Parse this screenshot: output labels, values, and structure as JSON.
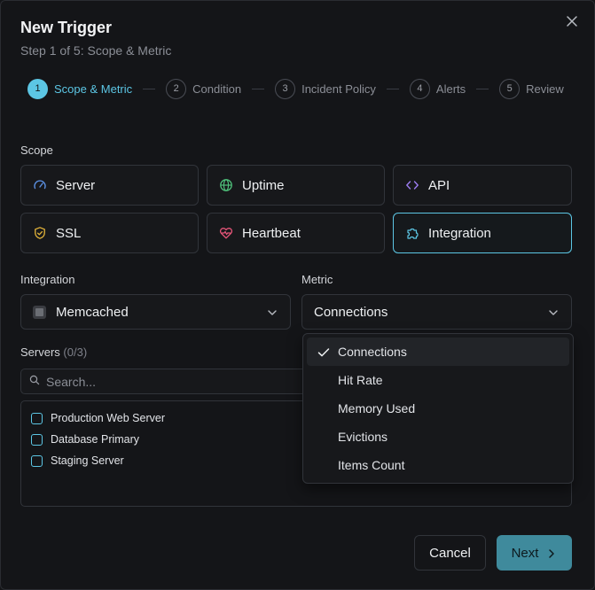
{
  "dialog": {
    "title": "New Trigger",
    "subtitle": "Step 1 of 5: Scope & Metric"
  },
  "steps": [
    {
      "number": "1",
      "label": "Scope & Metric",
      "active": true
    },
    {
      "number": "2",
      "label": "Condition",
      "active": false
    },
    {
      "number": "3",
      "label": "Incident Policy",
      "active": false
    },
    {
      "number": "4",
      "label": "Alerts",
      "active": false
    },
    {
      "number": "5",
      "label": "Review",
      "active": false
    }
  ],
  "scope": {
    "label": "Scope",
    "options": [
      {
        "label": "Server",
        "icon": "gauge-icon",
        "selected": false
      },
      {
        "label": "Uptime",
        "icon": "globe-icon",
        "selected": false
      },
      {
        "label": "API",
        "icon": "code-icon",
        "selected": false
      },
      {
        "label": "SSL",
        "icon": "shield-icon",
        "selected": false
      },
      {
        "label": "Heartbeat",
        "icon": "heart-pulse-icon",
        "selected": false
      },
      {
        "label": "Integration",
        "icon": "puzzle-icon",
        "selected": true
      }
    ]
  },
  "integration": {
    "label": "Integration",
    "value": "Memcached"
  },
  "metric": {
    "label": "Metric",
    "value": "Connections",
    "options": [
      "Connections",
      "Hit Rate",
      "Memory Used",
      "Evictions",
      "Items Count"
    ],
    "selected_index": 0
  },
  "servers": {
    "label": "Servers",
    "count": "(0/3)",
    "search_placeholder": "Search...",
    "items": [
      "Production Web Server",
      "Database Primary",
      "Staging Server"
    ]
  },
  "actions": {
    "cancel_label": "Cancel",
    "next_label": "Next"
  },
  "colors": {
    "accent": "#5cc6e4",
    "primary_button": "#3f8a9c",
    "background": "#141518",
    "border": "#31343a"
  }
}
